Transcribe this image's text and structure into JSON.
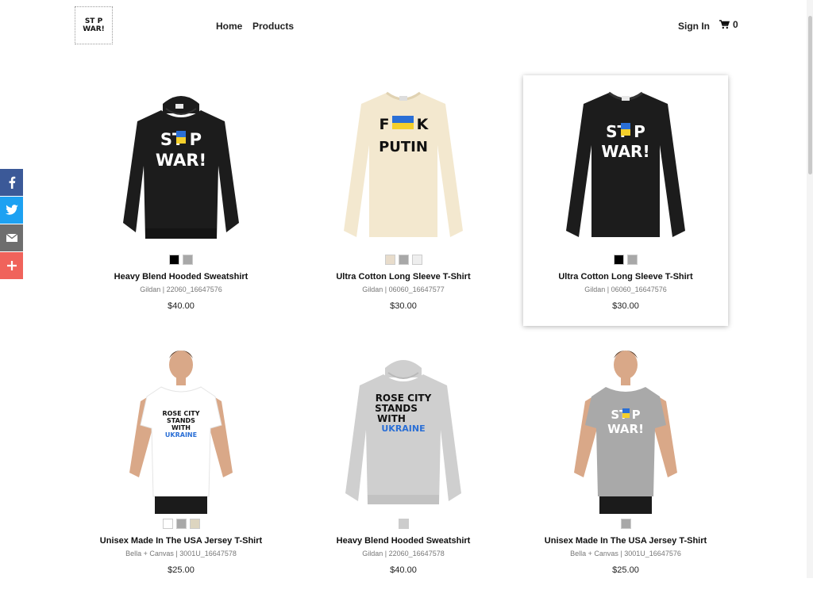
{
  "header": {
    "logo_text_line1": "ST P",
    "logo_text_line2": "WAR!",
    "nav_home": "Home",
    "nav_products": "Products",
    "sign_in": "Sign In",
    "cart_count": "0"
  },
  "social": [
    "facebook-icon",
    "twitter-icon",
    "email-icon",
    "plus-icon"
  ],
  "products": [
    {
      "name": "Heavy Blend Hooded Sweatshirt",
      "sku": "Gildan | 22060_16647576",
      "price": "$40.00",
      "print": [
        "ST P",
        "WAR!"
      ],
      "swatches": [
        "#000000",
        "#a8a8a8"
      ]
    },
    {
      "name": "Ultra Cotton Long Sleeve T-Shirt",
      "sku": "Gildan | 06060_16647577",
      "price": "$30.00",
      "print": [
        "F K",
        "PUTIN"
      ],
      "swatches": [
        "#e8dccb",
        "#a8a8a8",
        "#eeeeee"
      ]
    },
    {
      "name": "Ultra Cotton Long Sleeve T-Shirt",
      "sku": "Gildan | 06060_16647576",
      "price": "$30.00",
      "print": [
        "ST P",
        "WAR!"
      ],
      "swatches": [
        "#000000",
        "#a8a8a8"
      ]
    },
    {
      "name": "Unisex Made In The USA Jersey T-Shirt",
      "sku": "Bella + Canvas | 3001U_16647578",
      "price": "$25.00",
      "print": [
        "ROSE CITY",
        "STANDS",
        "WITH",
        "UKRAINE"
      ],
      "swatches": [
        "#ffffff",
        "#a8a8a8",
        "#ddd5c0"
      ]
    },
    {
      "name": "Heavy Blend Hooded Sweatshirt",
      "sku": "Gildan | 22060_16647578",
      "price": "$40.00",
      "print": [
        "ROSE CITY",
        "STANDS",
        "WITH",
        "UKRAINE"
      ],
      "swatches": [
        "#cccccc"
      ]
    },
    {
      "name": "Unisex Made In The USA Jersey T-Shirt",
      "sku": "Bella + Canvas | 3001U_16647576",
      "price": "$25.00",
      "print": [
        "ST P",
        "WAR!"
      ],
      "swatches": [
        "#a8a8a8"
      ]
    }
  ]
}
